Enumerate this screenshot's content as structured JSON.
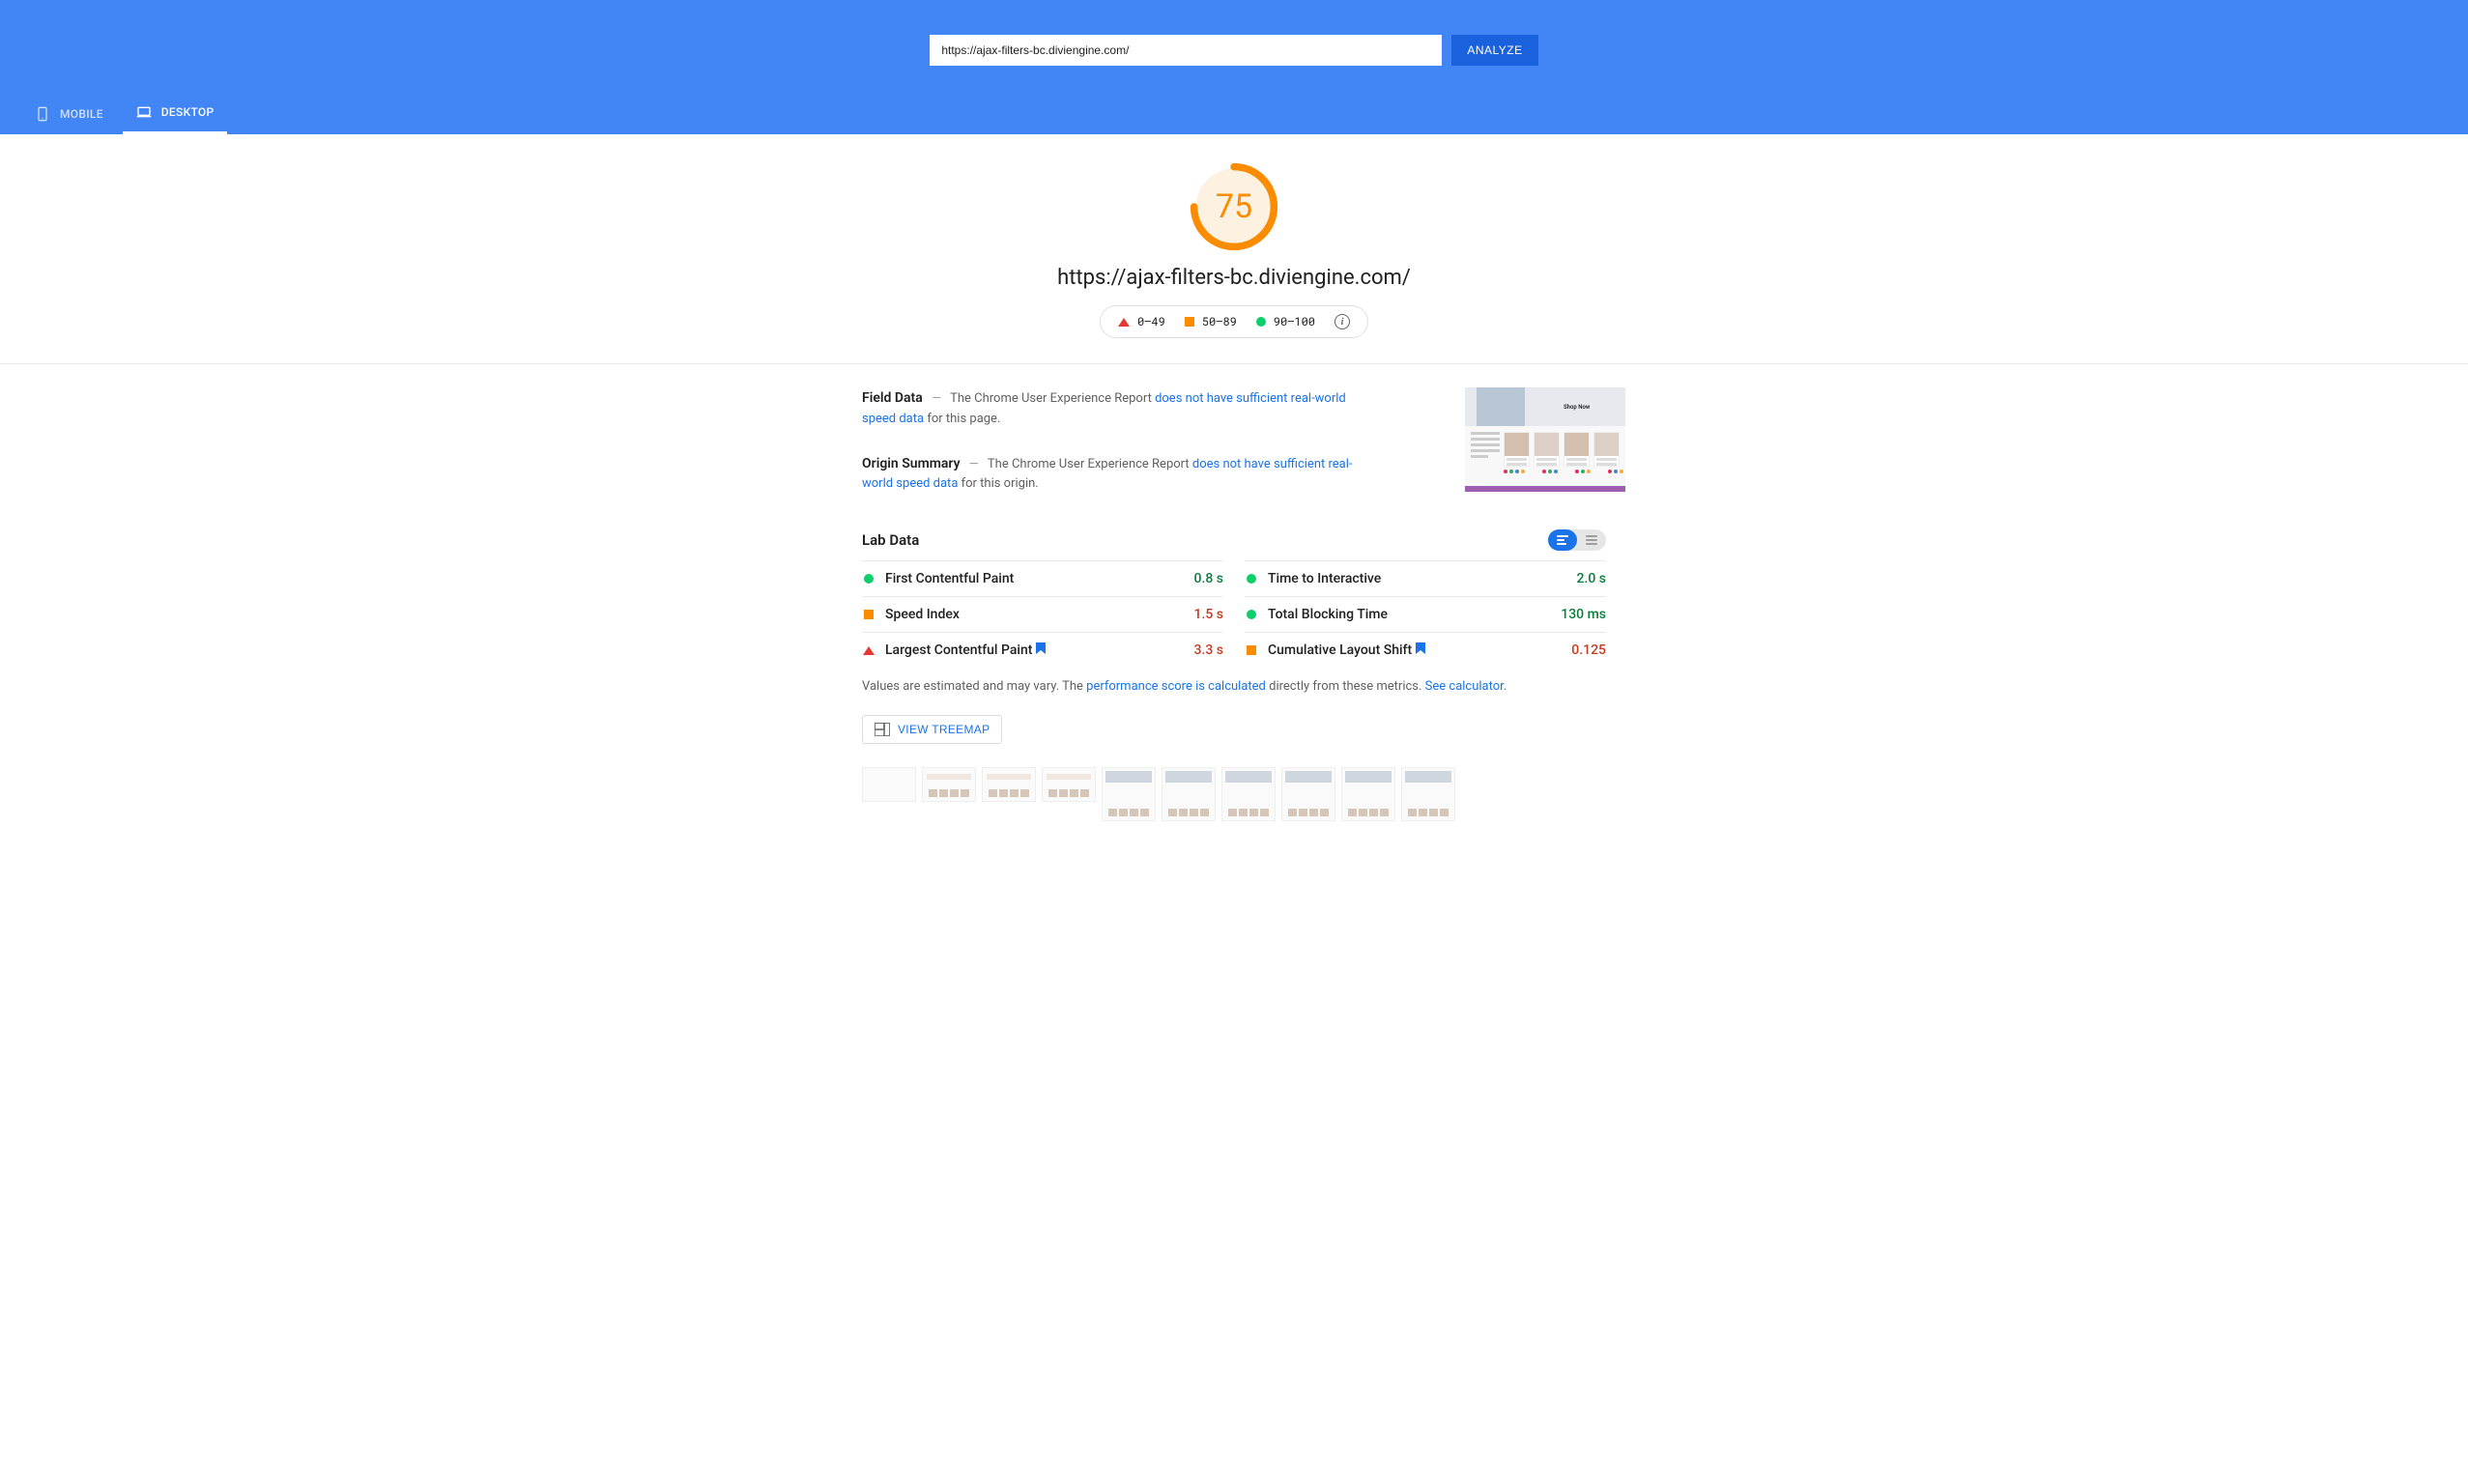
{
  "search": {
    "url_value": "https://ajax-filters-bc.diviengine.com/",
    "analyze_label": "ANALYZE"
  },
  "tabs": {
    "mobile": "MOBILE",
    "desktop": "DESKTOP",
    "active": "desktop"
  },
  "hero": {
    "score": "75",
    "page_url": "https://ajax-filters-bc.diviengine.com/",
    "legend": {
      "poor": "0–49",
      "avg": "50–89",
      "good": "90–100"
    }
  },
  "field_data": {
    "title": "Field Data",
    "lead": "The Chrome User Experience Report ",
    "link": "does not have sufficient real-world speed data",
    "trail": " for this page."
  },
  "origin_summary": {
    "title": "Origin Summary",
    "lead": "The Chrome User Experience Report ",
    "link": "does not have sufficient real-world speed data",
    "trail": " for this origin."
  },
  "lab": {
    "title": "Lab Data",
    "metrics": [
      {
        "name": "First Contentful Paint",
        "value": "0.8 s",
        "status": "good",
        "bookmark": false
      },
      {
        "name": "Time to Interactive",
        "value": "2.0 s",
        "status": "good",
        "bookmark": false
      },
      {
        "name": "Speed Index",
        "value": "1.5 s",
        "status": "avg",
        "bookmark": false
      },
      {
        "name": "Total Blocking Time",
        "value": "130 ms",
        "status": "good",
        "bookmark": false
      },
      {
        "name": "Largest Contentful Paint",
        "value": "3.3 s",
        "status": "poor",
        "bookmark": true
      },
      {
        "name": "Cumulative Layout Shift",
        "value": "0.125",
        "status": "avg",
        "bookmark": true
      }
    ],
    "footnote_lead": "Values are estimated and may vary. The ",
    "footnote_link1": "performance score is calculated",
    "footnote_mid": " directly from these metrics. ",
    "footnote_link2": "See calculator.",
    "treemap_btn": "VIEW TREEMAP"
  },
  "thumb": {
    "shop_now": "Shop Now"
  },
  "chart_data": {
    "type": "gauge",
    "value": 75,
    "range": [
      0,
      100
    ],
    "thresholds": [
      {
        "label": "poor",
        "range": [
          0,
          49
        ],
        "color": "#e53935"
      },
      {
        "label": "avg",
        "range": [
          50,
          89
        ],
        "color": "#fb8c00"
      },
      {
        "label": "good",
        "range": [
          90,
          100
        ],
        "color": "#0cce6b"
      }
    ],
    "ring_color": "#fb8c00"
  }
}
